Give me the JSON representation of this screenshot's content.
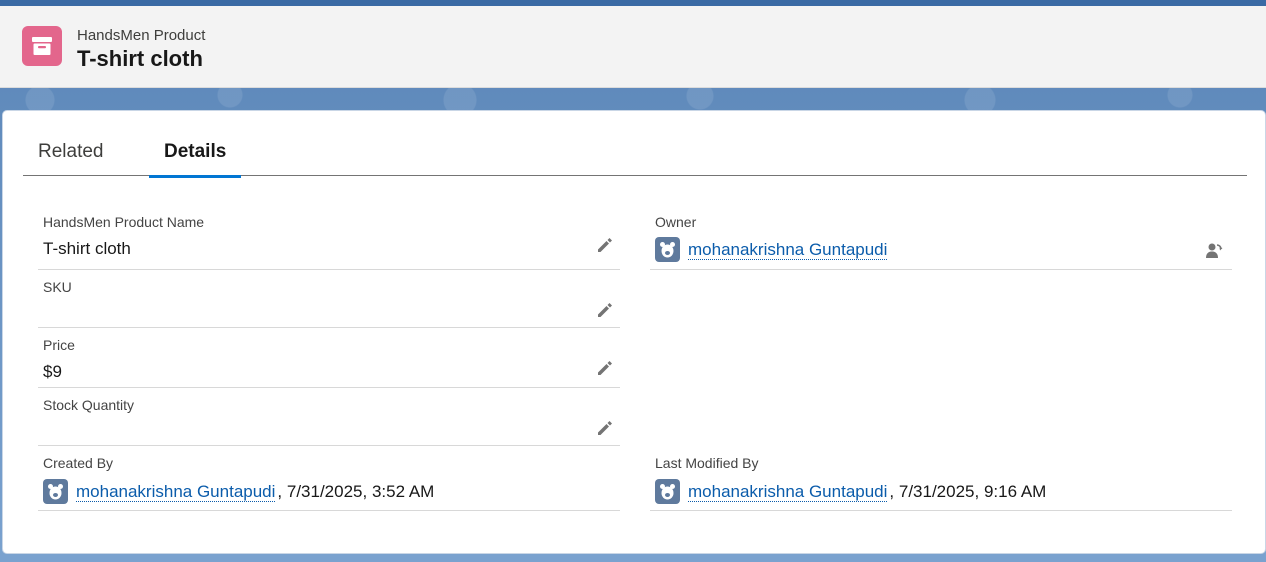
{
  "header": {
    "object_type": "HandsMen Product",
    "record_title": "T-shirt cloth",
    "icon": "product-box-icon",
    "icon_color": "#e3668c"
  },
  "tabs": [
    {
      "label": "Related",
      "active": false
    },
    {
      "label": "Details",
      "active": true
    }
  ],
  "fields": {
    "product_name": {
      "label": "HandsMen Product Name",
      "value": "T-shirt cloth"
    },
    "sku": {
      "label": "SKU",
      "value": ""
    },
    "price": {
      "label": "Price",
      "value": "$9"
    },
    "stock_quantity": {
      "label": "Stock Quantity",
      "value": ""
    },
    "owner": {
      "label": "Owner",
      "user": "mohanakrishna Guntapudi"
    },
    "created_by": {
      "label": "Created By",
      "user": "mohanakrishna Guntapudi",
      "timestamp": ", 7/31/2025, 3:52 AM"
    },
    "last_modified_by": {
      "label": "Last Modified By",
      "user": "mohanakrishna Guntapudi",
      "timestamp": ", 7/31/2025, 9:16 AM"
    }
  },
  "colors": {
    "accent": "#0176d3",
    "link": "#0b5cab",
    "avatar": "#5f7a9d"
  }
}
